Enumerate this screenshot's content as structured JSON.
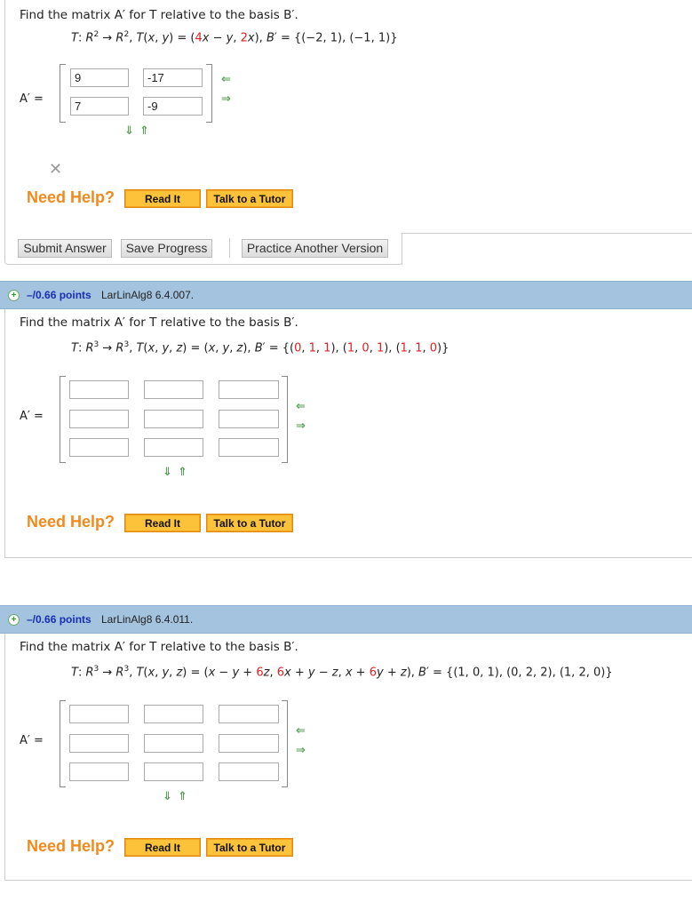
{
  "prompt": "Find the matrix A′ for T relative to the basis B′.",
  "help": {
    "need_help": "Need Help?",
    "read_it": "Read It",
    "tutor": "Talk to a Tutor"
  },
  "matrix_label": "A′ =",
  "p1": {
    "answers": [
      [
        "9",
        "-17"
      ],
      [
        "7",
        "-9"
      ]
    ],
    "status_icon": "incorrect-x-icon"
  },
  "actions": {
    "submit": "Submit Answer",
    "save": "Save Progress",
    "practice": "Practice Another Version"
  },
  "p2": {
    "points": "–/0.66 points",
    "source": "LarLinAlg8 6.4.007."
  },
  "p3": {
    "points": "–/0.66 points",
    "source": "LarLinAlg8 6.4.011."
  },
  "colors": {
    "header": "#a3c3df",
    "help": "#f08a1c",
    "button": "#fcc23a",
    "points": "#1a2fb0",
    "highlight": "#e02020"
  }
}
